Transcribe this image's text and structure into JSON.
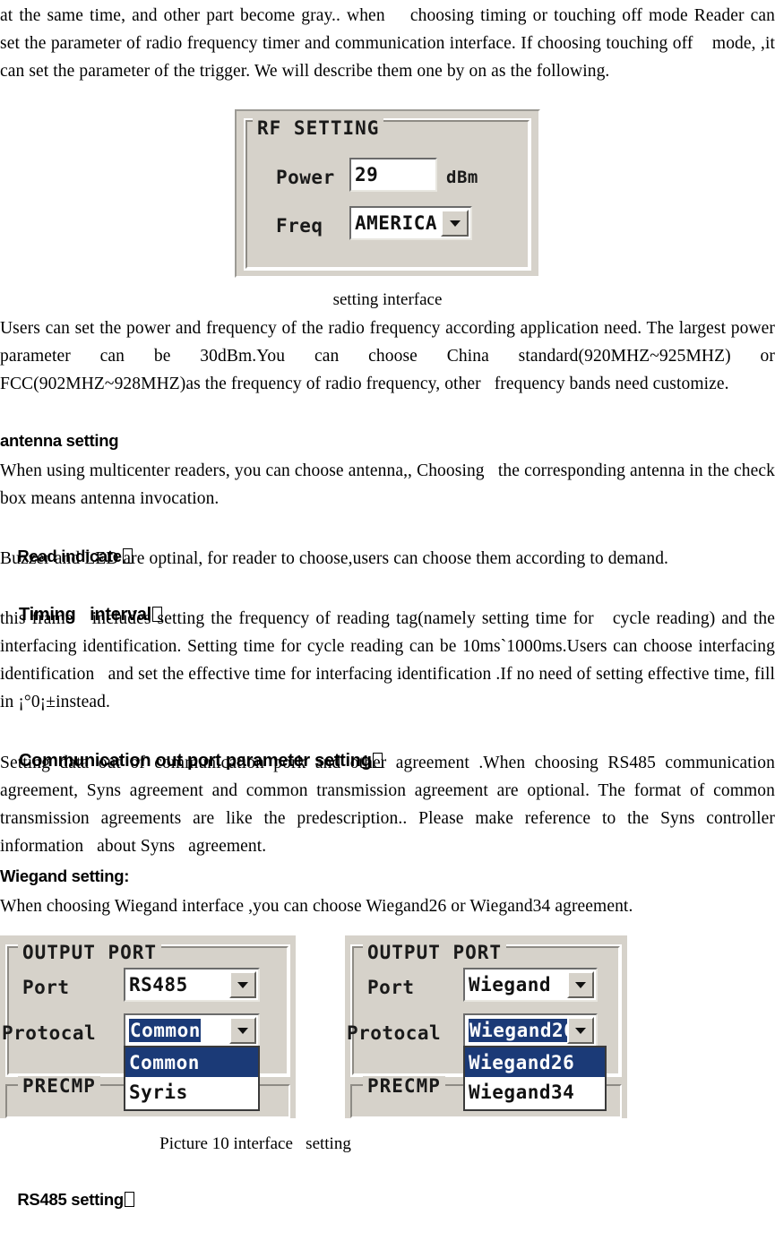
{
  "document": {
    "paragraphs": {
      "intro": "at the same time, and other part become gray.. when    choosing timing or touching off mode Reader can    set the parameter of radio frequency timer and communication interface. If choosing touching off    mode, ,it can set the parameter of the trigger. We will describe them one by on as the following.",
      "rf_caption": "setting interface",
      "rf_body": "Users can set the power and frequency of the radio frequency according application need. The largest power parameter can be 30dBm.You can choose China standard(920MHZ~925MHZ) or FCC(902MHZ~928MHZ)as the frequency of radio frequency, other   frequency bands need customize.",
      "antenna_body": "When using multicenter readers, you can choose antenna,, Choosing   the corresponding antenna in the check box means antenna invocation.",
      "read_indicate_body": "Buzzer and LED are optinal, for reader to choose,users can choose them according to demand.",
      "timing_body": "this frame   includes setting the frequency of reading tag(namely setting time for   cycle reading) and the interfacing identification. Setting time for cycle reading can be 10ms`1000ms.Users can choose interfacing identification   and set the effective time for interfacing identification .If no need of setting effective time, fill in ¡°0¡±instead.",
      "comm_body": "Setting data out of communication pork and other agreement .When choosing RS485 communication agreement, Syns agreement and common transmission agreement are optional. The format of common transmission agreements are like the predescription.. Please make reference to the Syns controller information   about Syns   agreement.",
      "wiegand_body": "When choosing Wiegand interface ,you can choose Wiegand26 or Wiegand34 agreement.",
      "picture10_caption": "Picture 10 interface   setting"
    },
    "headings": {
      "antenna": "antenna setting",
      "read_indicate": "Read indicate",
      "timing_interval": "Timing   interval",
      "communication": "Communication out port parameter setting",
      "wiegand": "Wiegand setting:",
      "rs485": "RS485 setting"
    }
  },
  "rf_dialog": {
    "group_title": "RF SETTING",
    "power_label": "Power",
    "power_value": "29",
    "power_unit": "dBm",
    "freq_label": "Freq",
    "freq_value": "AMERICA",
    "combo_arrow": "chevron-down-icon"
  },
  "output_port_left": {
    "group_title": "OUTPUT PORT",
    "port_label": "Port",
    "port_value": "RS485",
    "protocol_label": "Protocal",
    "protocol_value": "Common",
    "dropdown_options": [
      "Common",
      "Syris"
    ],
    "dropdown_selected_index": 0,
    "precmp_title": "PRECMP"
  },
  "output_port_right": {
    "group_title": "OUTPUT PORT",
    "port_label": "Port",
    "port_value": "Wiegand",
    "protocol_label": "Protocal",
    "protocol_value": "Wiegand26",
    "dropdown_options": [
      "Wiegand26",
      "Wiegand34"
    ],
    "dropdown_selected_index": 0,
    "precmp_title": "PRECMP"
  },
  "colors": {
    "dialog_face": "#d6d2ca",
    "selection_blue": "#1b3a77",
    "field_white": "#ffffff",
    "text_black": "#000000"
  }
}
